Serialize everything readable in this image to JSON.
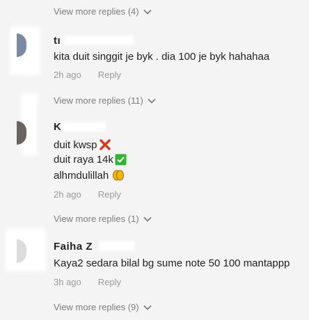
{
  "threads": [
    {
      "username": "tı",
      "lines": [
        "kita duit singgit je byk . dia 100 je byk hahahaa"
      ],
      "time": "2h ago",
      "reply_label": "Reply",
      "view_more": "View more replies (11)",
      "avatar_color": "#7a8aa3"
    },
    {
      "username": "K",
      "lines": [
        "duit kwsp",
        "duit raya 14k",
        "alhmdulillah"
      ],
      "line_emojis": [
        "cross-mark-icon",
        "check-mark-icon",
        "praying-hands-icon"
      ],
      "time": "2h ago",
      "reply_label": "Reply",
      "view_more": "View more replies (1)",
      "avatar_color": "#6b6461"
    },
    {
      "username": "Faiha Z",
      "lines": [
        "Kaya2 sedara bilal bg sume note 50 100 mantappp"
      ],
      "time": "3h ago",
      "reply_label": "Reply",
      "view_more": "View more replies (9)",
      "avatar_color": "#c9c9c9"
    }
  ],
  "top_view_more": "View more replies (4)",
  "colors": {
    "background": "#f4f4f4",
    "text": "#1f1f1f",
    "meta": "#9a9a9a",
    "cross": "#d9381e",
    "check": "#2fb52f",
    "pray": "#f2b705"
  }
}
